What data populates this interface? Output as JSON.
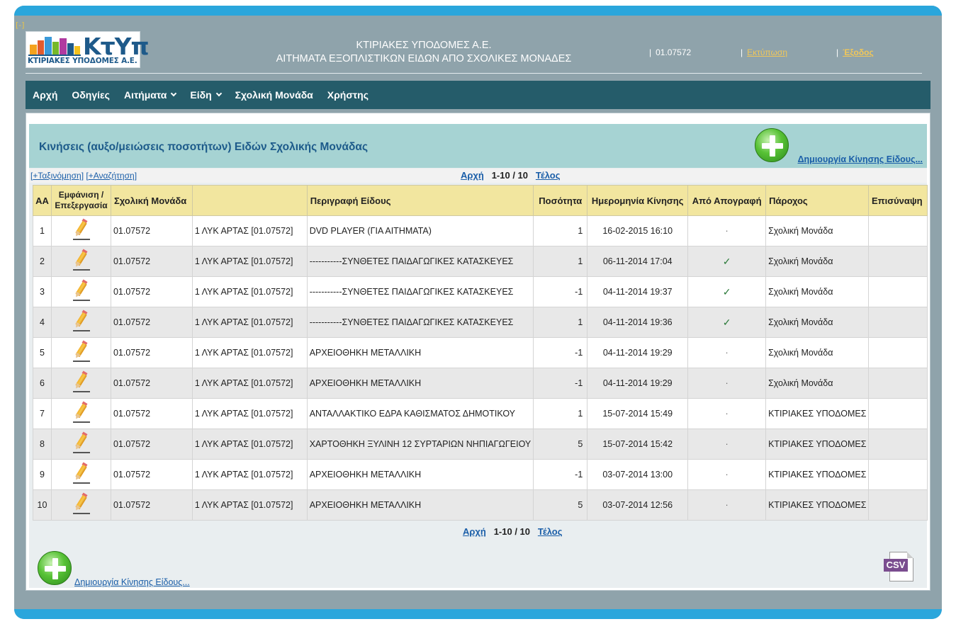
{
  "header": {
    "collapse_label": "[-]",
    "logo_text": "ΚτΥπ",
    "logo_subtitle": "ΚΤΙΡΙΑΚΕΣ ΥΠΟΔΟΜΕΣ Α.Ε.",
    "title_line1": "ΚΤΙΡΙΑΚΕΣ ΥΠΟΔΟΜΕΣ Α.Ε.",
    "title_line2": "ΑΙΤΗΜΑΤΑ ΕΞΟΠΛΙΣΤΙΚΩΝ ΕΙΔΩΝ ΑΠΟ ΣΧΟΛΙΚΕΣ ΜΟΝΑΔΕΣ",
    "separator": "|",
    "user_code": "01.07572",
    "print_label": "Εκτύπωση",
    "exit_label": "Έξοδος"
  },
  "nav": {
    "items": [
      {
        "label": "Αρχή",
        "dropdown": false
      },
      {
        "label": "Οδηγίες",
        "dropdown": false
      },
      {
        "label": "Αιτήματα",
        "dropdown": true
      },
      {
        "label": "Είδη",
        "dropdown": true
      },
      {
        "label": "Σχολική Μονάδα",
        "dropdown": false
      },
      {
        "label": "Χρήστης",
        "dropdown": false
      }
    ]
  },
  "section": {
    "title": "Κινήσεις (αυξο/μειώσεις ποσοτήτων) Ειδών Σχολικής Μονάδας",
    "create_label": "Δημιουργία Κίνησης Είδους..."
  },
  "toolbar": {
    "sort_label": "+Ταξινόμηση",
    "search_label": "+Αναζήτηση"
  },
  "pager": {
    "first": "Αρχή",
    "range": "1-10 / 10",
    "last": "Τέλος"
  },
  "table": {
    "headers": [
      "ΑΑ",
      "Εμφάνιση / Επεξεργασία",
      "Σχολική Μονάδα",
      "",
      "Περιγραφή Είδους",
      "Ποσότητα",
      "Ημερομηνία Κίνησης",
      "Από Απογραφή",
      "Πάροχος",
      "Επισύναψη"
    ],
    "rows": [
      {
        "aa": "1",
        "unit": "01.07572",
        "unit_name": "1 ΛΥΚ ΑΡΤΑΣ [01.07572]",
        "desc": "DVD PLAYER (ΓΙΑ ΑΙΤΗΜΑΤΑ)",
        "qty": "1",
        "date": "16-02-2015 16:10",
        "inventory": "·",
        "provider": "Σχολική Μονάδα",
        "attach": ""
      },
      {
        "aa": "2",
        "unit": "01.07572",
        "unit_name": "1 ΛΥΚ ΑΡΤΑΣ [01.07572]",
        "desc": "-----------ΣΥΝΘΕΤΕΣ ΠΑΙΔΑΓΩΓΙΚΕΣ ΚΑΤΑΣΚΕΥΕΣ",
        "qty": "1",
        "date": "06-11-2014 17:04",
        "inventory": "✓",
        "provider": "Σχολική Μονάδα",
        "attach": ""
      },
      {
        "aa": "3",
        "unit": "01.07572",
        "unit_name": "1 ΛΥΚ ΑΡΤΑΣ [01.07572]",
        "desc": "-----------ΣΥΝΘΕΤΕΣ ΠΑΙΔΑΓΩΓΙΚΕΣ ΚΑΤΑΣΚΕΥΕΣ",
        "qty": "-1",
        "date": "04-11-2014 19:37",
        "inventory": "✓",
        "provider": "Σχολική Μονάδα",
        "attach": ""
      },
      {
        "aa": "4",
        "unit": "01.07572",
        "unit_name": "1 ΛΥΚ ΑΡΤΑΣ [01.07572]",
        "desc": "-----------ΣΥΝΘΕΤΕΣ ΠΑΙΔΑΓΩΓΙΚΕΣ ΚΑΤΑΣΚΕΥΕΣ",
        "qty": "1",
        "date": "04-11-2014 19:36",
        "inventory": "✓",
        "provider": "Σχολική Μονάδα",
        "attach": ""
      },
      {
        "aa": "5",
        "unit": "01.07572",
        "unit_name": "1 ΛΥΚ ΑΡΤΑΣ [01.07572]",
        "desc": "ΑΡΧΕΙΟΘΗΚΗ ΜΕΤΑΛΛΙΚΗ",
        "qty": "-1",
        "date": "04-11-2014 19:29",
        "inventory": "·",
        "provider": "Σχολική Μονάδα",
        "attach": ""
      },
      {
        "aa": "6",
        "unit": "01.07572",
        "unit_name": "1 ΛΥΚ ΑΡΤΑΣ [01.07572]",
        "desc": "ΑΡΧΕΙΟΘΗΚΗ ΜΕΤΑΛΛΙΚΗ",
        "qty": "-1",
        "date": "04-11-2014 19:29",
        "inventory": "·",
        "provider": "Σχολική Μονάδα",
        "attach": ""
      },
      {
        "aa": "7",
        "unit": "01.07572",
        "unit_name": "1 ΛΥΚ ΑΡΤΑΣ [01.07572]",
        "desc": "ΑΝΤΑΛΛΑΚΤΙΚΟ ΕΔΡΑ ΚΑΘΙΣΜΑΤΟΣ ΔΗΜΟΤΙΚΟΥ",
        "qty": "1",
        "date": "15-07-2014 15:49",
        "inventory": "·",
        "provider": "ΚΤΙΡΙΑΚΕΣ ΥΠΟΔΟΜΕΣ",
        "attach": ""
      },
      {
        "aa": "8",
        "unit": "01.07572",
        "unit_name": "1 ΛΥΚ ΑΡΤΑΣ [01.07572]",
        "desc": "ΧΑΡΤΟΘΗΚΗ ΞΥΛΙΝΗ 12 ΣΥΡΤΑΡΙΩΝ ΝΗΠΙΑΓΩΓΕΙΟΥ",
        "qty": "5",
        "date": "15-07-2014 15:42",
        "inventory": "·",
        "provider": "ΚΤΙΡΙΑΚΕΣ ΥΠΟΔΟΜΕΣ",
        "attach": ""
      },
      {
        "aa": "9",
        "unit": "01.07572",
        "unit_name": "1 ΛΥΚ ΑΡΤΑΣ [01.07572]",
        "desc": "ΑΡΧΕΙΟΘΗΚΗ ΜΕΤΑΛΛΙΚΗ",
        "qty": "-1",
        "date": "03-07-2014 13:00",
        "inventory": "·",
        "provider": "ΚΤΙΡΙΑΚΕΣ ΥΠΟΔΟΜΕΣ",
        "attach": ""
      },
      {
        "aa": "10",
        "unit": "01.07572",
        "unit_name": "1 ΛΥΚ ΑΡΤΑΣ [01.07572]",
        "desc": "ΑΡΧΕΙΟΘΗΚΗ ΜΕΤΑΛΛΙΚΗ",
        "qty": "5",
        "date": "03-07-2014 12:56",
        "inventory": "·",
        "provider": "ΚΤΙΡΙΑΚΕΣ ΥΠΟΔΟΜΕΣ",
        "attach": ""
      }
    ]
  },
  "footer": {
    "create_label": "Δημιουργία Κίνησης Είδους...",
    "csv_label": "CSV"
  },
  "icons": {
    "edit": "pencil-icon",
    "create": "plus-circle-icon",
    "export": "csv-file-icon",
    "checked": "checkmark-icon"
  },
  "colors": {
    "frame": "#8fa3ab",
    "frame_border": "#2aa6dc",
    "nav": "#255c6a",
    "section_head": "#a6d3d3",
    "table_header": "#f2e69f",
    "link": "#1a5ea8",
    "header_link": "#f0c75a"
  }
}
